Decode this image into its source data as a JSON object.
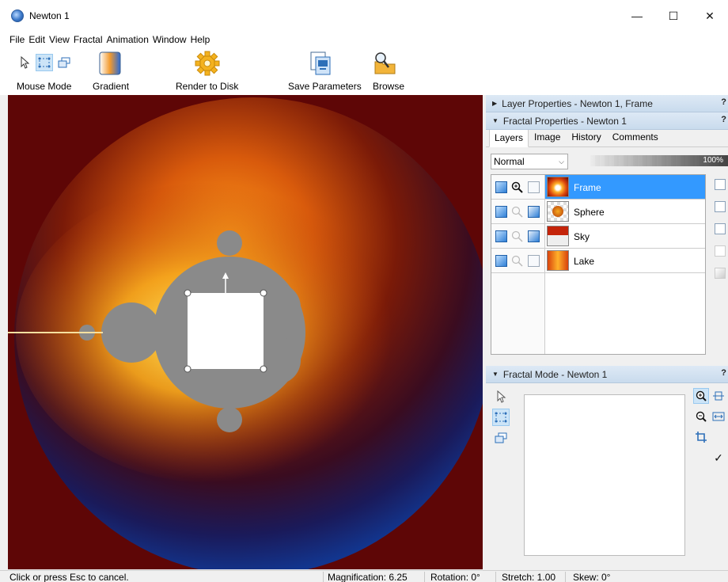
{
  "window": {
    "title": "Newton 1",
    "minimize": "—",
    "maximize": "☐",
    "close": "✕"
  },
  "menu": [
    "File",
    "Edit",
    "View",
    "Fractal",
    "Animation",
    "Window",
    "Help"
  ],
  "toolbar": {
    "mouse_mode": "Mouse Mode",
    "gradient": "Gradient",
    "render": "Render to Disk",
    "save_params": "Save Parameters",
    "browse": "Browse"
  },
  "layer_properties": {
    "title": "Layer Properties - Newton 1, Frame",
    "help": "?"
  },
  "fractal_properties": {
    "title": "Fractal Properties - Newton 1",
    "help": "?",
    "tabs": [
      "Layers",
      "Image",
      "History",
      "Comments"
    ],
    "blend_mode": "Normal",
    "opacity_text": "100%",
    "opacity_value": 1.0,
    "layers": [
      {
        "name": "Frame",
        "selected": true
      },
      {
        "name": "Sphere",
        "selected": false
      },
      {
        "name": "Sky",
        "selected": false
      },
      {
        "name": "Lake",
        "selected": false
      }
    ]
  },
  "fractal_mode": {
    "title": "Fractal Mode - Newton 1",
    "help": "?",
    "check": "✓"
  },
  "status": {
    "message": "Click or press Esc to cancel.",
    "magnification": "Magnification: 6.25",
    "rotation": "Rotation: 0°",
    "stretch": "Stretch: 1.00",
    "skew": "Skew: 0°"
  },
  "colors": {
    "accent": "#3399ff",
    "fractal_bg": "#5e0606",
    "fractal_body": "#8a8a8a"
  }
}
